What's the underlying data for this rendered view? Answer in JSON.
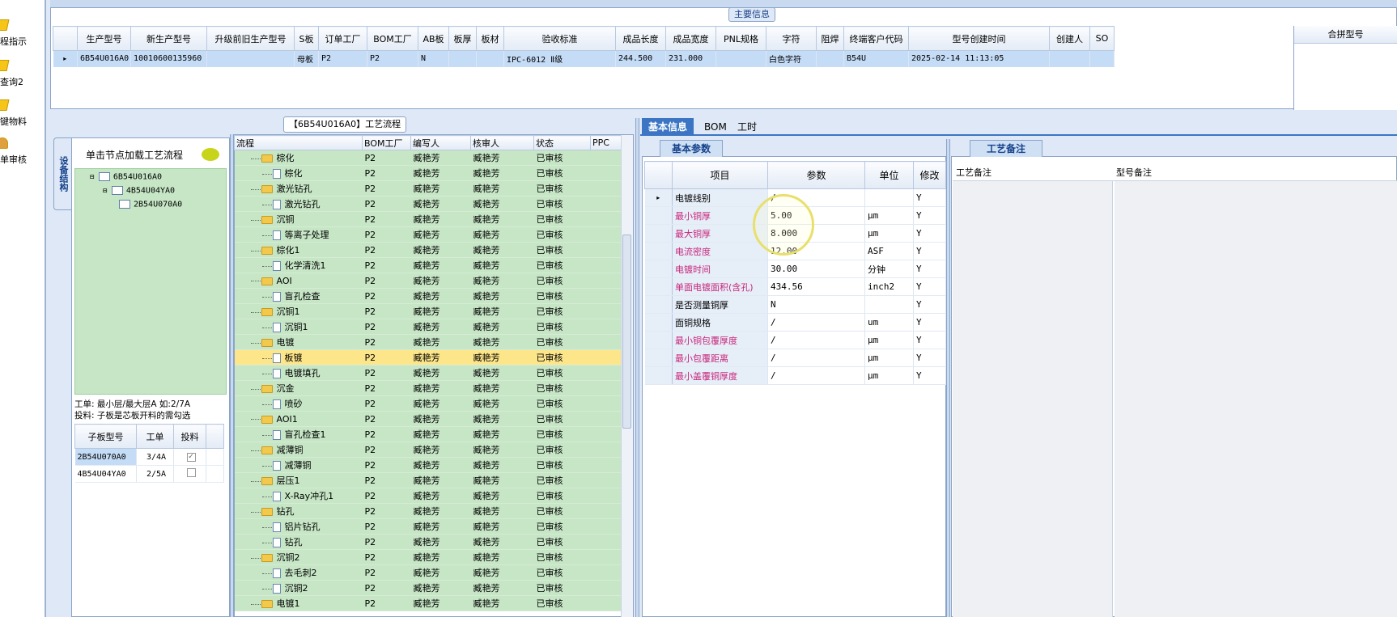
{
  "left_nav": {
    "items": [
      {
        "label": "程指示",
        "icon": "lightning-icon"
      },
      {
        "label": "查询2",
        "icon": "lightning-icon"
      },
      {
        "label": "键物料",
        "icon": "lightning-icon"
      },
      {
        "label": "单审核",
        "icon": "person-icon"
      }
    ]
  },
  "main_info": {
    "title": "主要信息",
    "columns": [
      "生产型号",
      "新生产型号",
      "升级前旧生产型号",
      "S板",
      "订单工厂",
      "BOM工厂",
      "AB板",
      "板厚",
      "板材",
      "验收标准",
      "成品长度",
      "成品宽度",
      "PNL规格",
      "字符",
      "阻焊",
      "终端客户代码",
      "型号创建时间",
      "创建人",
      "SO"
    ],
    "row": [
      "6B54U016A0",
      "10010600135960",
      "",
      "母板",
      "P2",
      "P2",
      "N",
      "",
      "",
      "IPC-6012 Ⅱ级",
      "244.500",
      "231.000",
      "",
      "白色字符",
      "",
      "B54U",
      "2025-02-14 11:13:05",
      "",
      ""
    ],
    "merge_column": "合拼型号"
  },
  "structure": {
    "tab_label": "设备结构",
    "header": "单击节点加载工艺流程",
    "tree": [
      {
        "label": "6B54U016A0",
        "level": 0
      },
      {
        "label": "4B54U04YA0",
        "level": 1
      },
      {
        "label": "2B54U070A0",
        "level": 2
      }
    ],
    "hint_line1": "工单: 最小层/最大层A 如:2/7A",
    "hint_line2": "投料: 子板是芯板开料的需勾选",
    "sub_columns": [
      "子板型号",
      "工单",
      "投料"
    ],
    "sub_rows": [
      {
        "model": "2B54U070A0",
        "order": "3/4A",
        "checked": true
      },
      {
        "model": "4B54U04YA0",
        "order": "2/5A",
        "checked": false
      }
    ]
  },
  "process": {
    "title": "【6B54U016A0】工艺流程",
    "columns": [
      "流程",
      "BOM工厂",
      "编写人",
      "核审人",
      "状态",
      "PPC"
    ],
    "rows": [
      {
        "name": "棕化",
        "type": "folder",
        "factory": "P2",
        "writer": "臧艳芳",
        "auditor": "臧艳芳",
        "status": "已审核"
      },
      {
        "name": "棕化",
        "type": "doc",
        "factory": "P2",
        "writer": "臧艳芳",
        "auditor": "臧艳芳",
        "status": "已审核"
      },
      {
        "name": "激光钻孔",
        "type": "folder",
        "factory": "P2",
        "writer": "臧艳芳",
        "auditor": "臧艳芳",
        "status": "已审核"
      },
      {
        "name": "激光钻孔",
        "type": "doc",
        "factory": "P2",
        "writer": "臧艳芳",
        "auditor": "臧艳芳",
        "status": "已审核"
      },
      {
        "name": "沉铜",
        "type": "folder",
        "factory": "P2",
        "writer": "臧艳芳",
        "auditor": "臧艳芳",
        "status": "已审核"
      },
      {
        "name": "等离子处理",
        "type": "doc",
        "factory": "P2",
        "writer": "臧艳芳",
        "auditor": "臧艳芳",
        "status": "已审核"
      },
      {
        "name": "棕化1",
        "type": "folder",
        "factory": "P2",
        "writer": "臧艳芳",
        "auditor": "臧艳芳",
        "status": "已审核"
      },
      {
        "name": "化学清洗1",
        "type": "doc",
        "factory": "P2",
        "writer": "臧艳芳",
        "auditor": "臧艳芳",
        "status": "已审核"
      },
      {
        "name": "AOI",
        "type": "folder",
        "factory": "P2",
        "writer": "臧艳芳",
        "auditor": "臧艳芳",
        "status": "已审核"
      },
      {
        "name": "盲孔检查",
        "type": "doc",
        "factory": "P2",
        "writer": "臧艳芳",
        "auditor": "臧艳芳",
        "status": "已审核"
      },
      {
        "name": "沉铜1",
        "type": "folder",
        "factory": "P2",
        "writer": "臧艳芳",
        "auditor": "臧艳芳",
        "status": "已审核"
      },
      {
        "name": "沉铜1",
        "type": "doc",
        "factory": "P2",
        "writer": "臧艳芳",
        "auditor": "臧艳芳",
        "status": "已审核"
      },
      {
        "name": "电镀",
        "type": "folder",
        "factory": "P2",
        "writer": "臧艳芳",
        "auditor": "臧艳芳",
        "status": "已审核"
      },
      {
        "name": "板镀",
        "type": "doc",
        "factory": "P2",
        "writer": "臧艳芳",
        "auditor": "臧艳芳",
        "status": "已审核",
        "highlight": true
      },
      {
        "name": "电镀填孔",
        "type": "doc",
        "factory": "P2",
        "writer": "臧艳芳",
        "auditor": "臧艳芳",
        "status": "已审核"
      },
      {
        "name": "沉金",
        "type": "folder",
        "factory": "P2",
        "writer": "臧艳芳",
        "auditor": "臧艳芳",
        "status": "已审核"
      },
      {
        "name": "喷砂",
        "type": "doc",
        "factory": "P2",
        "writer": "臧艳芳",
        "auditor": "臧艳芳",
        "status": "已审核"
      },
      {
        "name": "AOI1",
        "type": "folder",
        "factory": "P2",
        "writer": "臧艳芳",
        "auditor": "臧艳芳",
        "status": "已审核"
      },
      {
        "name": "盲孔检查1",
        "type": "doc",
        "factory": "P2",
        "writer": "臧艳芳",
        "auditor": "臧艳芳",
        "status": "已审核"
      },
      {
        "name": "减薄铜",
        "type": "folder",
        "factory": "P2",
        "writer": "臧艳芳",
        "auditor": "臧艳芳",
        "status": "已审核"
      },
      {
        "name": "减薄铜",
        "type": "doc",
        "factory": "P2",
        "writer": "臧艳芳",
        "auditor": "臧艳芳",
        "status": "已审核"
      },
      {
        "name": "层压1",
        "type": "folder",
        "factory": "P2",
        "writer": "臧艳芳",
        "auditor": "臧艳芳",
        "status": "已审核"
      },
      {
        "name": "X-Ray冲孔1",
        "type": "doc",
        "factory": "P2",
        "writer": "臧艳芳",
        "auditor": "臧艳芳",
        "status": "已审核"
      },
      {
        "name": "钻孔",
        "type": "folder",
        "factory": "P2",
        "writer": "臧艳芳",
        "auditor": "臧艳芳",
        "status": "已审核"
      },
      {
        "name": "铝片钻孔",
        "type": "doc",
        "factory": "P2",
        "writer": "臧艳芳",
        "auditor": "臧艳芳",
        "status": "已审核"
      },
      {
        "name": "钻孔",
        "type": "doc",
        "factory": "P2",
        "writer": "臧艳芳",
        "auditor": "臧艳芳",
        "status": "已审核"
      },
      {
        "name": "沉铜2",
        "type": "folder",
        "factory": "P2",
        "writer": "臧艳芳",
        "auditor": "臧艳芳",
        "status": "已审核"
      },
      {
        "name": "去毛刺2",
        "type": "doc",
        "factory": "P2",
        "writer": "臧艳芳",
        "auditor": "臧艳芳",
        "status": "已审核"
      },
      {
        "name": "沉铜2",
        "type": "doc",
        "factory": "P2",
        "writer": "臧艳芳",
        "auditor": "臧艳芳",
        "status": "已审核"
      },
      {
        "name": "电镀1",
        "type": "folder",
        "factory": "P2",
        "writer": "臧艳芳",
        "auditor": "臧艳芳",
        "status": "已审核"
      }
    ]
  },
  "right_tabs": [
    "基本信息",
    "BOM",
    "工时"
  ],
  "basic": {
    "tab": "基本参数",
    "columns": [
      "项目",
      "参数",
      "单位",
      "修改"
    ],
    "rows": [
      {
        "item": "电镀线别",
        "value": "/",
        "unit": "",
        "mod": "Y",
        "pink": false,
        "current": true
      },
      {
        "item": "最小铜厚",
        "value": "5.00",
        "unit": "μm",
        "mod": "Y",
        "pink": true
      },
      {
        "item": "最大铜厚",
        "value": "8.000",
        "unit": "μm",
        "mod": "Y",
        "pink": true
      },
      {
        "item": "电流密度",
        "value": "12.00",
        "unit": "ASF",
        "mod": "Y",
        "pink": true
      },
      {
        "item": "电镀时间",
        "value": "30.00",
        "unit": "分钟",
        "mod": "Y",
        "pink": true
      },
      {
        "item": "单面电镀面积(含孔)",
        "value": "434.56",
        "unit": "inch2",
        "mod": "Y",
        "pink": true
      },
      {
        "item": "是否测量铜厚",
        "value": "N",
        "unit": "",
        "mod": "Y",
        "pink": false
      },
      {
        "item": "面铜规格",
        "value": "/",
        "unit": "um",
        "mod": "Y",
        "pink": false
      },
      {
        "item": "最小铜包覆厚度",
        "value": "/",
        "unit": "μm",
        "mod": "Y",
        "pink": true
      },
      {
        "item": "最小包覆距离",
        "value": "/",
        "unit": "μm",
        "mod": "Y",
        "pink": true
      },
      {
        "item": "最小盖覆铜厚度",
        "value": "/",
        "unit": "μm",
        "mod": "Y",
        "pink": true
      }
    ]
  },
  "remarks": {
    "tab": "工艺备注",
    "col_left": "工艺备注",
    "col_right": "型号备注"
  }
}
